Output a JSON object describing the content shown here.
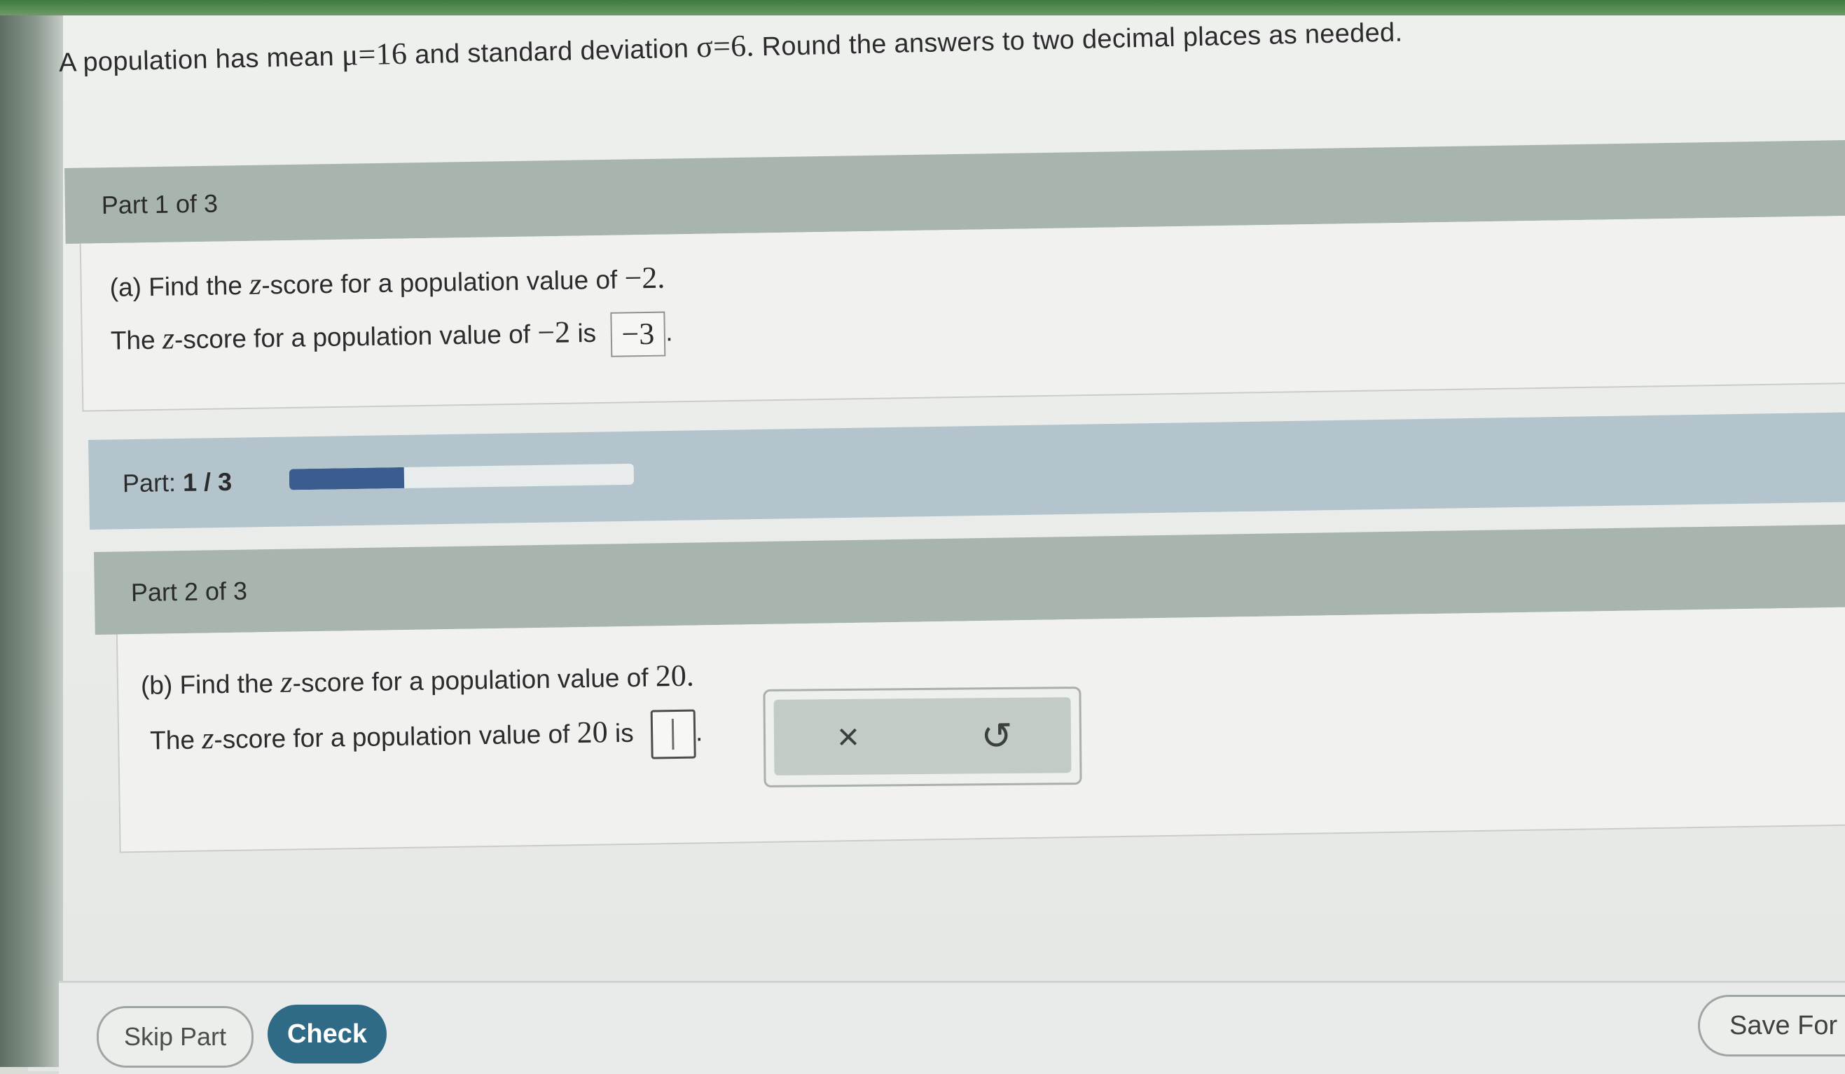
{
  "problem": {
    "intro": "A population has mean",
    "mu_symbol": "μ",
    "mu_eq": "=16",
    "and_sd": "and standard deviation",
    "sigma_symbol": "σ",
    "sigma_eq": "=6.",
    "instruction": "Round the answers to two decimal places as needed."
  },
  "part1": {
    "header": "Part 1 of 3",
    "question_prefix": "(a) Find the",
    "z_symbol": "z",
    "question_suffix": "-score for a population value of",
    "question_value": "−2.",
    "answer_prefix": "The",
    "answer_middle": "-score for a population value of",
    "answer_value": "−2",
    "answer_is": "is",
    "answer": "−3",
    "period": "."
  },
  "progress": {
    "label": "Part:",
    "current": "1 / 3",
    "fraction": 0.333
  },
  "part2": {
    "header": "Part 2 of 3",
    "question_prefix": "(b) Find the",
    "z_symbol": "z",
    "question_suffix": "-score for a population value of",
    "question_value": "20.",
    "answer_prefix": "The",
    "answer_middle": "-score for a population value of",
    "answer_value": "20",
    "answer_is": "is",
    "answer_input_value": "",
    "period": "."
  },
  "tools": {
    "clear_icon": "×",
    "undo_icon": "↺"
  },
  "buttons": {
    "skip": "Skip Part",
    "check": "Check",
    "save": "Save For"
  },
  "colors": {
    "check_button": "#2f6a86",
    "progress_fill": "#3a5c8e",
    "part_header": "#a8b5ad"
  }
}
